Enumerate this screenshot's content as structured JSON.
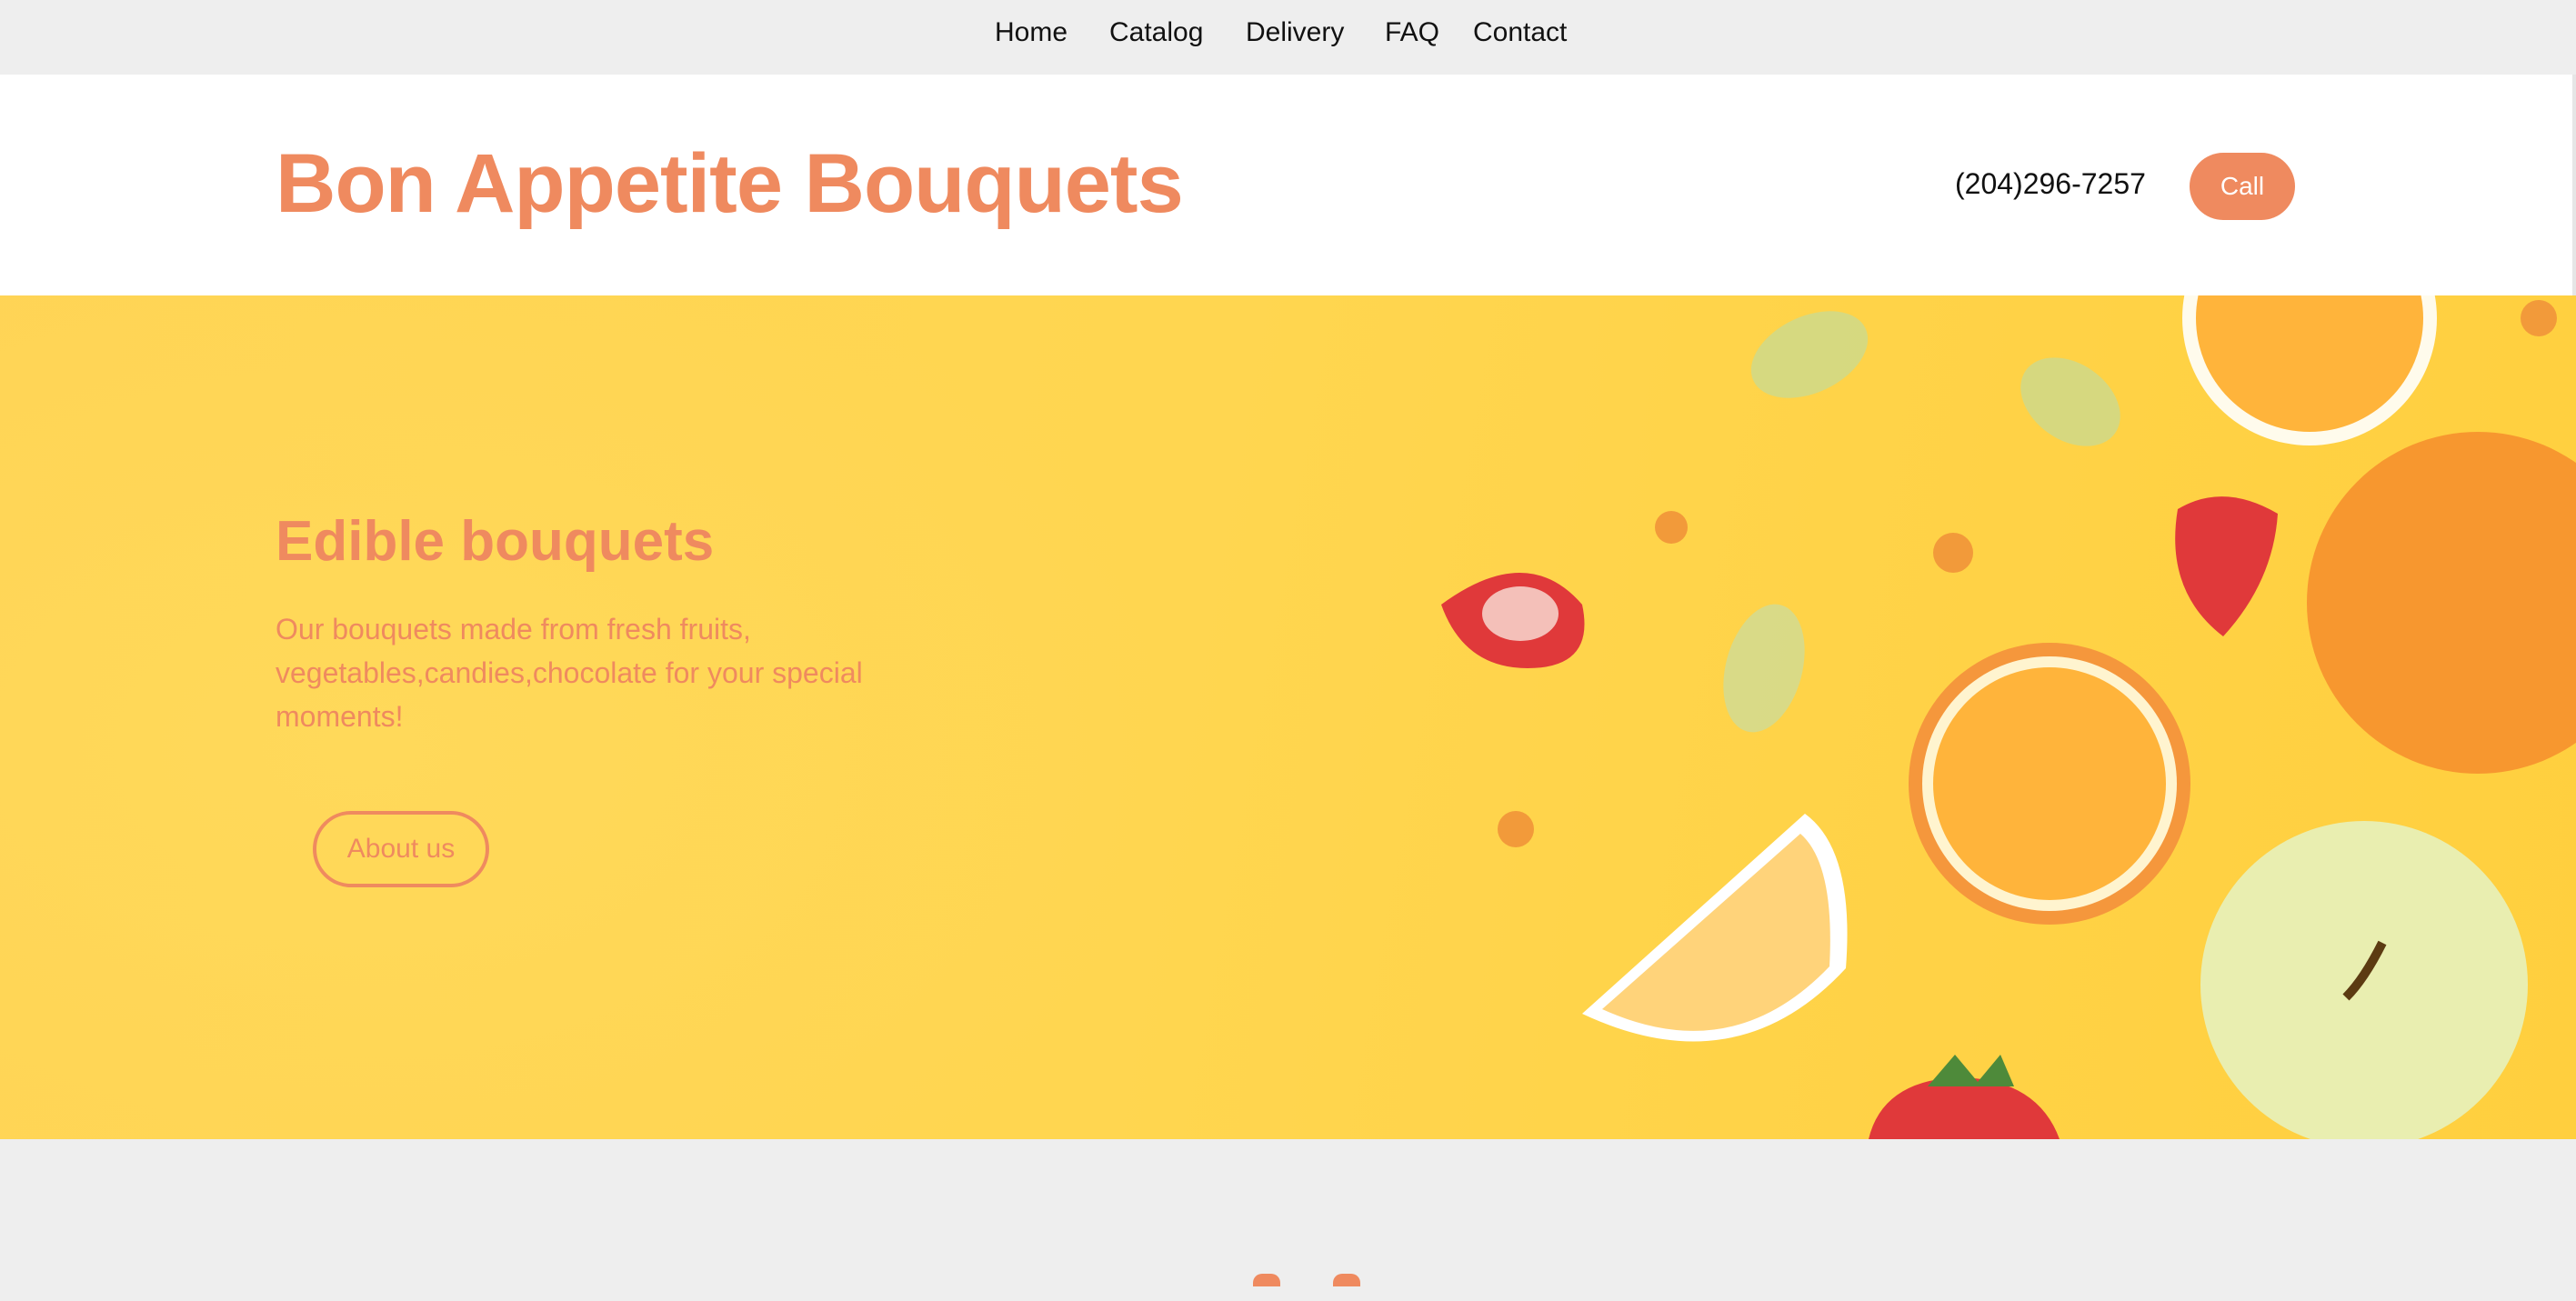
{
  "nav": {
    "items": [
      "Home",
      "Catalog",
      "Delivery",
      "FAQ",
      "Contact"
    ]
  },
  "header": {
    "brand": "Bon Appetite Bouquets",
    "phone": "(204)296-7257",
    "call_label": "Call"
  },
  "hero": {
    "title": "Edible bouquets",
    "description": "Our bouquets made from fresh fruits, vegetables,candies,chocolate for your special moments!",
    "about_label": "About us"
  },
  "colors": {
    "accent": "#ef8a5f",
    "hero_bg": "#ffd455",
    "page_bg": "#eeeeee"
  }
}
